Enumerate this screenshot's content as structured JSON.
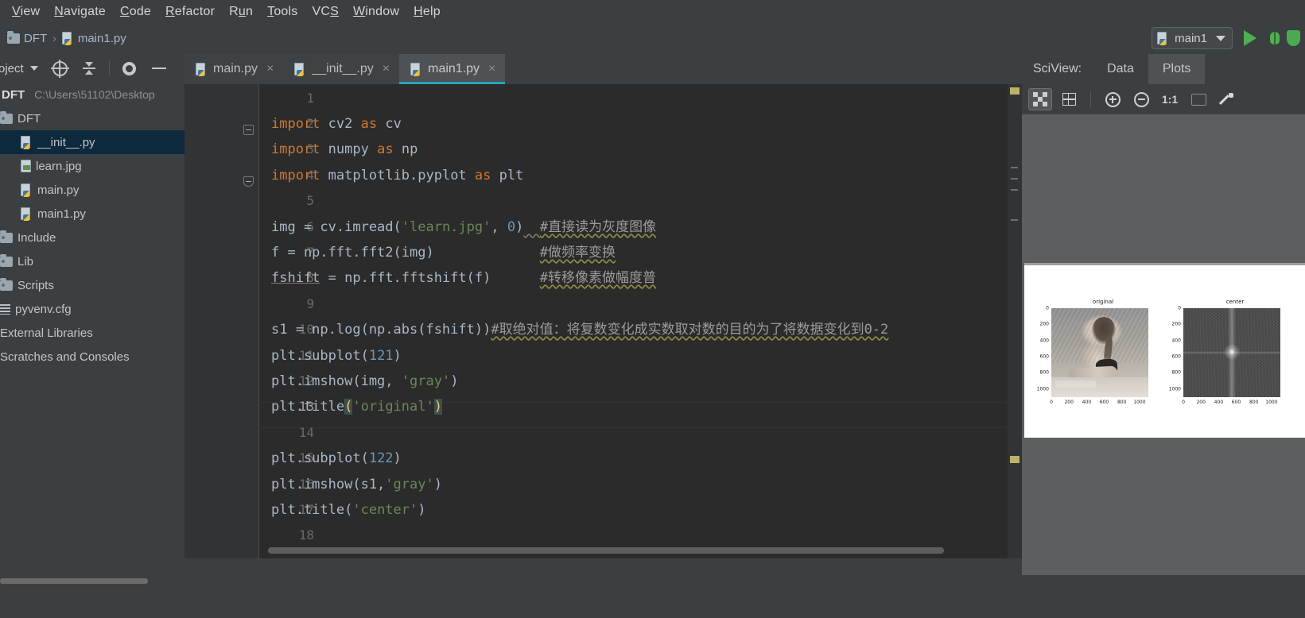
{
  "menu": {
    "items": [
      {
        "label": "View",
        "mnemonic": "V"
      },
      {
        "label": "Navigate",
        "mnemonic": "N"
      },
      {
        "label": "Code",
        "mnemonic": "C"
      },
      {
        "label": "Refactor",
        "mnemonic": "R"
      },
      {
        "label": "Run",
        "mnemonic": "u"
      },
      {
        "label": "Tools",
        "mnemonic": "T"
      },
      {
        "label": "VCS",
        "mnemonic": "S"
      },
      {
        "label": "Window",
        "mnemonic": "W"
      },
      {
        "label": "Help",
        "mnemonic": "H"
      }
    ]
  },
  "breadcrumb": {
    "project": "DFT",
    "separator": "›",
    "file": "main1.py"
  },
  "run_toolbar": {
    "config_name": "main1",
    "run_label": "Run",
    "debug_label": "Debug",
    "coverage_label": "Run with Coverage"
  },
  "project_panel": {
    "title": "oject",
    "toolbar": {
      "select_target": "select-opened-file",
      "collapse_all": "collapse-all",
      "settings": "settings",
      "hide": "hide"
    },
    "root": {
      "name": "DFT",
      "path": "C:\\Users\\51102\\Desktop"
    },
    "items": [
      {
        "label": "DFT",
        "icon": "folder-icon",
        "indent": 1,
        "selected": false
      },
      {
        "label": "__init__.py",
        "icon": "python-file-icon",
        "indent": 2,
        "selected": true
      },
      {
        "label": "learn.jpg",
        "icon": "image-file-icon",
        "indent": 2,
        "selected": false
      },
      {
        "label": "main.py",
        "icon": "python-file-icon",
        "indent": 2,
        "selected": false
      },
      {
        "label": "main1.py",
        "icon": "python-file-icon",
        "indent": 2,
        "selected": false
      },
      {
        "label": "Include",
        "icon": "folder-icon",
        "indent": 1,
        "selected": false
      },
      {
        "label": "Lib",
        "icon": "folder-icon",
        "indent": 1,
        "selected": false
      },
      {
        "label": "Scripts",
        "icon": "folder-icon",
        "indent": 1,
        "selected": false
      },
      {
        "label": "pyvenv.cfg",
        "icon": "config-file-icon",
        "indent": 1,
        "selected": false
      },
      {
        "label": "External Libraries",
        "icon": "none",
        "indent": 0,
        "selected": false
      },
      {
        "label": "Scratches and Consoles",
        "icon": "none",
        "indent": 0,
        "selected": false
      }
    ]
  },
  "editor": {
    "tabs": [
      {
        "label": "main.py",
        "active": false,
        "close": "×"
      },
      {
        "label": "__init__.py",
        "active": false,
        "close": "×"
      },
      {
        "label": "main1.py",
        "active": true,
        "close": "×"
      }
    ],
    "lines": [
      {
        "n": "1",
        "code": ""
      },
      {
        "n": "2",
        "code": "import cv2 as cv"
      },
      {
        "n": "3",
        "code": "import numpy as np"
      },
      {
        "n": "4",
        "code": "import matplotlib.pyplot as plt"
      },
      {
        "n": "5",
        "code": ""
      },
      {
        "n": "6",
        "code": "img = cv.imread('learn.jpg', 0)  #直接读为灰度图像"
      },
      {
        "n": "7",
        "code": "f = np.fft.fft2(img)             #做频率变换"
      },
      {
        "n": "8",
        "code": "fshift = np.fft.fftshift(f)      #转移像素做幅度普"
      },
      {
        "n": "9",
        "code": ""
      },
      {
        "n": "10",
        "code": "s1 = np.log(np.abs(fshift))#取绝对值：将复数变化成实数取对数的目的为了将数据变化到0-2"
      },
      {
        "n": "11",
        "code": "plt.subplot(121)"
      },
      {
        "n": "12",
        "code": "plt.imshow(img, 'gray')"
      },
      {
        "n": "13",
        "code": "plt.title('original')"
      },
      {
        "n": "14",
        "code": ""
      },
      {
        "n": "15",
        "code": "plt.subplot(122)"
      },
      {
        "n": "16",
        "code": "plt.imshow(s1,'gray')"
      },
      {
        "n": "17",
        "code": "plt.title('center')"
      },
      {
        "n": "18",
        "code": ""
      }
    ],
    "syntax": {
      "keyword_color": "#cc7832",
      "string_color": "#6a8759",
      "number_color": "#6897bb",
      "comment_color": "#9b9b9b",
      "default_color": "#a9b7c6",
      "background": "#2b2b2b",
      "gutter_background": "#313335"
    },
    "caret_line": "13"
  },
  "sciview": {
    "label": "SciView:",
    "tabs": [
      {
        "label": "Data",
        "active": false
      },
      {
        "label": "Plots",
        "active": true
      }
    ],
    "toolbar": [
      {
        "name": "pixel-view-icon",
        "selected": true
      },
      {
        "name": "grid-view-icon",
        "selected": false
      },
      {
        "name": "zoom-in-icon",
        "selected": false
      },
      {
        "name": "zoom-out-icon",
        "selected": false
      },
      {
        "name": "actual-size-icon",
        "label": "1:1",
        "selected": false
      },
      {
        "name": "fit-to-window-icon",
        "selected": false
      },
      {
        "name": "color-picker-icon",
        "selected": false
      }
    ]
  },
  "chart_data": {
    "type": "heatmap",
    "title": "",
    "figure_background": "#ffffff",
    "subplots": [
      {
        "index": 121,
        "title": "original",
        "cmap": "gray",
        "source": "learn.jpg grayscale image",
        "xticks": [
          0,
          200,
          400,
          600,
          800,
          1000
        ],
        "yticks": [
          0,
          200,
          400,
          600,
          800,
          1000
        ],
        "xlim": [
          0,
          1100
        ],
        "ylim": [
          1100,
          0
        ],
        "grid": false
      },
      {
        "index": 122,
        "title": "center",
        "cmap": "gray",
        "source": "log magnitude spectrum of fftshift(fft2(img))",
        "xticks": [
          0,
          200,
          400,
          600,
          800,
          1000
        ],
        "yticks": [
          0,
          200,
          400,
          600,
          800,
          1000
        ],
        "xlim": [
          0,
          1100
        ],
        "ylim": [
          1100,
          0
        ],
        "grid": false
      }
    ],
    "legend_position": "none"
  }
}
